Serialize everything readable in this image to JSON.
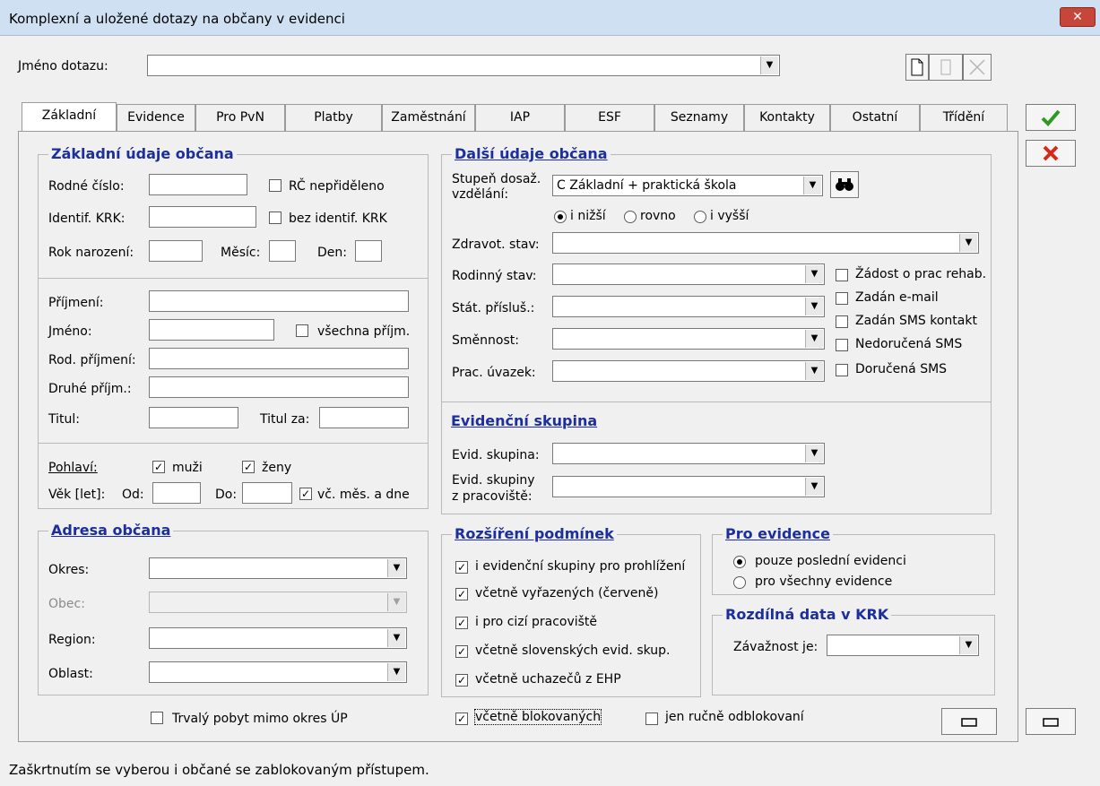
{
  "window": {
    "title": "Komplexní a uložené dotazy na občany v evidenci",
    "close": "✕"
  },
  "query": {
    "label": "Jméno dotazu:",
    "value": ""
  },
  "tabs": [
    "Základní",
    "Evidence",
    "Pro PvN",
    "Platby",
    "Zaměstnání",
    "IAP",
    "ESF",
    "Seznamy",
    "Kontakty",
    "Ostatní",
    "Třídění"
  ],
  "basic": {
    "title": "Základní údaje občana",
    "rodne_cislo": "Rodné číslo:",
    "rc_neprideleno": "RČ nepřiděleno",
    "identif_krk": "Identif. KRK:",
    "bez_identif": "bez identif. KRK",
    "rok_narozeni": "Rok narození:",
    "mesic": "Měsíc:",
    "den": "Den:",
    "prijmeni": "Příjmení:",
    "jmeno": "Jméno:",
    "vsechna_prijm": "všechna příjm.",
    "rod_prijmeni": "Rod. příjmení:",
    "druhe_prijm": "Druhé příjm.:",
    "titul": "Titul:",
    "titul_za": "Titul za:",
    "pohlavi": "Pohlaví:",
    "muzi": "muži",
    "zeny": "ženy",
    "vek": "Věk [let]:",
    "od": "Od:",
    "do": "Do:",
    "vc_mes": "vč. měs. a dne"
  },
  "address": {
    "title": "Adresa občana",
    "okres": "Okres:",
    "obec": "Obec:",
    "region": "Region:",
    "oblast": "Oblast:",
    "trvaly": "Trvalý pobyt mimo okres ÚP"
  },
  "other": {
    "title": "Další údaje občana",
    "stupen1": "Stupeň dosaž.",
    "stupen2": "vzdělání:",
    "stupen_value": "C Základní + praktická škola",
    "i_nizsi": "i nižší",
    "rovno": "rovno",
    "i_vyssi": "i vyšší",
    "zdravot": "Zdravot. stav:",
    "rodinny": "Rodinný stav:",
    "stat": "Stát. přísluš.:",
    "smennost": "Směnnost:",
    "uvazek": "Prac. úvazek:",
    "zadost": "Žádost o prac rehab.",
    "email": "Zadán e-mail",
    "sms_kontakt": "Zadán SMS kontakt",
    "nedorucena": "Nedoručená SMS",
    "dorucena": "Doručená SMS"
  },
  "evid": {
    "title": "Evidenční skupina",
    "skupina": "Evid. skupina:",
    "skupiny1": "Evid. skupiny",
    "skupiny2": "z pracoviště:"
  },
  "rozsireni": {
    "title": "Rozšíření podmínek",
    "items": [
      "i evidenční skupiny pro prohlížení",
      "včetně vyřazených (červeně)",
      "i pro cizí pracoviště",
      "včetně slovenských evid. skup.",
      "včetně uchazečů z EHP"
    ],
    "blokovanych": "včetně blokovaných",
    "odblokovani": "jen ručně odblokovaní"
  },
  "pro_evidence": {
    "title": "Pro evidence",
    "posledni": "pouze poslední evidenci",
    "vsechny": "pro všechny evidence"
  },
  "krk": {
    "title": "Rozdílná data v KRK",
    "zavaznost": "Závažnost je:"
  },
  "status_text": "Zaškrtnutím se vyberou i občané se zablokovaným přístupem.",
  "colors": {
    "group_title": "#1c2f9c",
    "ok": "#2e9a1f",
    "cancel": "#d42a1a"
  }
}
